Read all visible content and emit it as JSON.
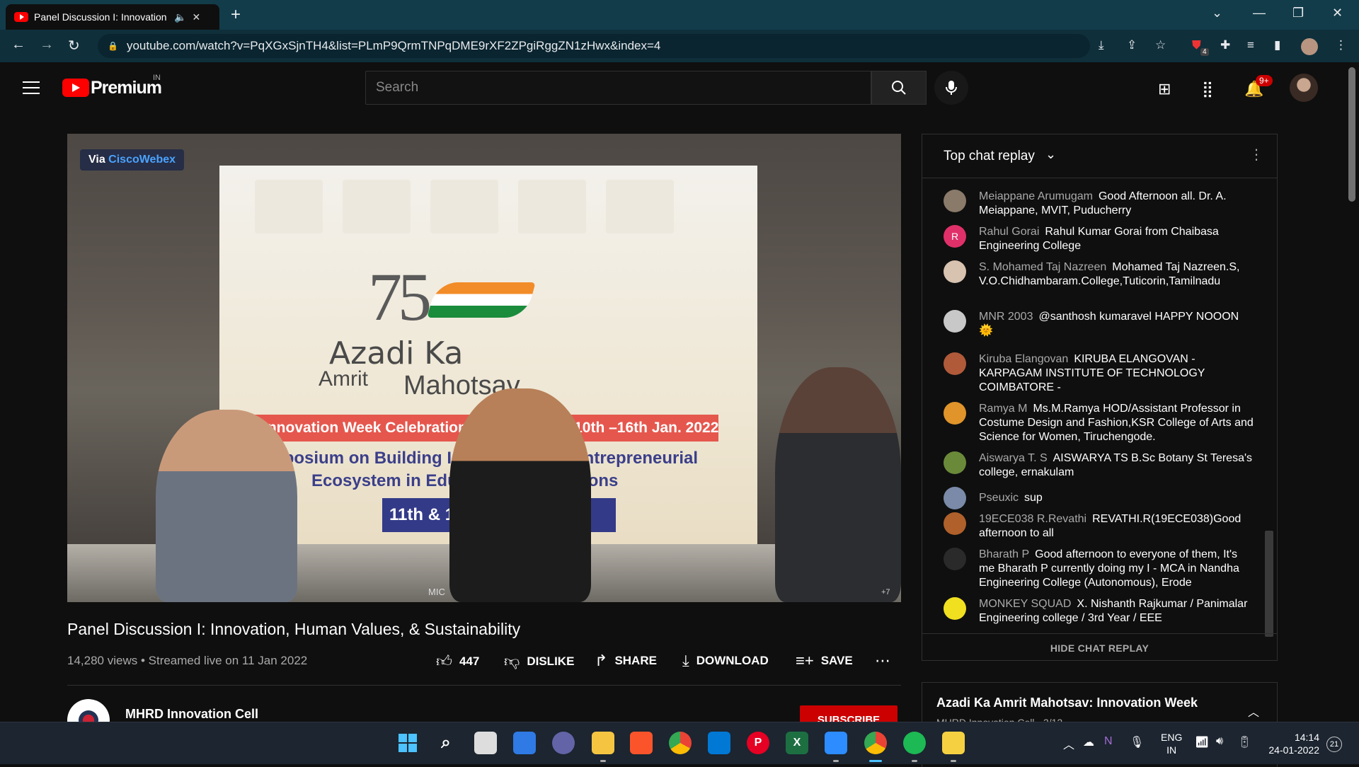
{
  "browser": {
    "tab_title": "Panel Discussion I: Innovation",
    "url": "youtube.com/watch?v=PqXGxSjnTH4&list=PLmP9QrmTNPqDME9rXF2ZPgiRggZN1zHwx&index=4",
    "extension_badge": "4"
  },
  "header": {
    "logo_text": "Premium",
    "country": "IN",
    "search_placeholder": "Search",
    "notification_badge": "9+"
  },
  "video": {
    "webex_prefix": "Via ",
    "webex_brand": "CiscoWebex",
    "banner_75": "75",
    "banner_azadi": "Azadi Ka",
    "banner_amrit": "Amrit",
    "banner_mahotsav": "Mahotsav",
    "banner_red": "Innovation Week Celebration (Virtual Mode) 10th –16th Jan. 2022",
    "banner_sym1": "Symposium on Building Innovation and Entrepreneurial",
    "banner_sym2": "Ecosystem in Educational Institutions",
    "banner_date": "11th & 12th Jan. 2022",
    "mic_label": "MIC",
    "count_label": "+7",
    "title": "Panel Discussion I: Innovation, Human Values, & Sustainability",
    "views": "14,280 views • Streamed live on 11 Jan 2022",
    "likes": "447",
    "dislike": "DISLIKE",
    "share": "SHARE",
    "download": "DOWNLOAD",
    "save": "SAVE"
  },
  "channel": {
    "name": "MHRD Innovation Cell",
    "subscribe": "SUBSCRIBE"
  },
  "chat": {
    "title": "Top chat replay",
    "hide": "HIDE CHAT REPLAY",
    "messages": [
      {
        "author": "Meiappane Arumugam",
        "text": "Good Afternoon all. Dr. A. Meiappane, MVIT, Puducherry",
        "color": "#8a7a6a"
      },
      {
        "author": "Rahul Gorai",
        "text": "Rahul Kumar Gorai from Chaibasa Engineering College",
        "color": "#e0306a",
        "initial": "R"
      },
      {
        "author": "S. Mohamed Taj Nazreen",
        "text": "Mohamed Taj Nazreen.S, V.O.Chidhambaram.College,Tuticorin,Tamilnadu",
        "color": "#d8c2b0"
      },
      {
        "author": "MNR 2003",
        "text": "@santhosh kumaravel HAPPY NOOON 🌞",
        "color": "#c8c8c8"
      },
      {
        "author": "Kiruba Elangovan",
        "text": "KIRUBA ELANGOVAN - KARPAGAM INSTITUTE OF TECHNOLOGY COIMBATORE -",
        "color": "#b05a3a"
      },
      {
        "author": "Ramya M",
        "text": "Ms.M.Ramya HOD/Assistant Professor in Costume Design and Fashion,KSR College of Arts and Science for Women, Tiruchengode.",
        "color": "#e0942a"
      },
      {
        "author": "Aiswarya T. S",
        "text": "AISWARYA TS B.Sc Botany St Teresa's college, ernakulam",
        "color": "#6a8a3a"
      },
      {
        "author": "Pseuxic",
        "text": "sup",
        "color": "#7a8aa8"
      },
      {
        "author": "19ECE038 R.Revathi",
        "text": "REVATHI.R(19ECE038)Good afternoon to all",
        "color": "#b0602a"
      },
      {
        "author": "Bharath P",
        "text": "Good afternoon to everyone of them, It's me Bharath P currently doing my I - MCA in Nandha Engineering College (Autonomous), Erode",
        "color": "#2a2a2a"
      },
      {
        "author": "MONKEY SQUAD",
        "text": "X. Nishanth Rajkumar / Panimalar Engineering college / 3rd Year / EEE",
        "color": "#f0e020"
      }
    ]
  },
  "playlist": {
    "title": "Azadi Ka Amrit Mahotsav: Innovation Week",
    "sub": "MHRD Innovation Cell - 3/12"
  },
  "taskbar": {
    "lang1": "ENG",
    "lang2": "IN",
    "time": "14:14",
    "date": "24-01-2022",
    "notif_count": "21"
  }
}
